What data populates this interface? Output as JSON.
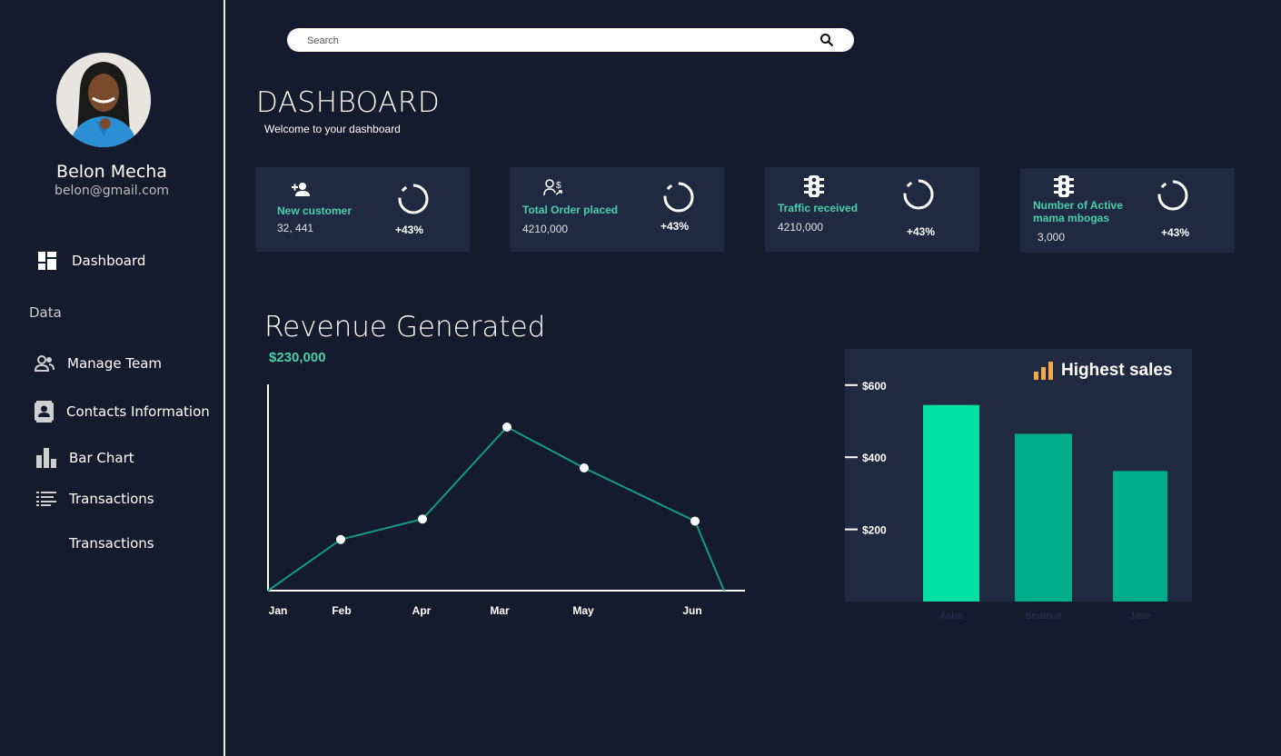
{
  "sidebar": {
    "user_name": "Belon Mecha",
    "user_email": "belon@gmail.com",
    "avatar_icon": "user-photo",
    "items": [
      {
        "label": "Dashboard",
        "icon": "dashboard-icon"
      },
      {
        "label": "Manage Team",
        "icon": "people-icon"
      },
      {
        "label": "Contacts Information",
        "icon": "contacts-icon"
      },
      {
        "label": "Bar Chart",
        "icon": "bar-chart-icon"
      },
      {
        "label": "Transactions",
        "icon": "list-icon"
      },
      {
        "label": "Transactions",
        "icon": ""
      }
    ],
    "section_label": "Data"
  },
  "search": {
    "placeholder": "Search",
    "icon": "search-icon"
  },
  "header": {
    "title": "DASHBOARD",
    "subtitle": "Welcome to your dashboard"
  },
  "cards": [
    {
      "label": "New customer",
      "value": "32, 441",
      "change": "+43%",
      "icon": "person-add-icon"
    },
    {
      "label": "Total Order placed",
      "value": "4210,000",
      "change": "+43%",
      "icon": "people-dollar-icon"
    },
    {
      "label": "Traffic received",
      "value": "4210,000",
      "change": "+43%",
      "icon": "traffic-light-icon"
    },
    {
      "label_line1": "Number of Active",
      "label_line2": "mama mbogas",
      "value": "3,000",
      "change": "+43%",
      "icon": "traffic-light-icon"
    }
  ],
  "revenue": {
    "title": "Revenue Generated",
    "amount": "$230,000"
  },
  "colors": {
    "accent": "#4cceac",
    "background": "#141b2d",
    "panel": "#1f2a40",
    "bar_bright": "#00e0a4",
    "bar": "#00ad8a",
    "line": "#139b85"
  },
  "chart_data": [
    {
      "type": "line",
      "categories": [
        "Jan",
        "Feb",
        "Apr",
        "Mar",
        "May",
        "Jun",
        ""
      ],
      "values": [
        0,
        25,
        35,
        80,
        60,
        34,
        0
      ],
      "ylim": [
        0,
        100
      ],
      "title": "",
      "xlabel": "",
      "ylabel": ""
    },
    {
      "type": "bar",
      "title": "Highest sales",
      "categories": [
        "Asha",
        "Beatrice",
        "Jane"
      ],
      "values": [
        545,
        465,
        362
      ],
      "yticks": [
        "$600",
        "$400",
        "$200"
      ],
      "ytick_values": [
        600,
        400,
        200
      ],
      "ylim": [
        0,
        650
      ],
      "xlabel": "",
      "ylabel": ""
    }
  ]
}
